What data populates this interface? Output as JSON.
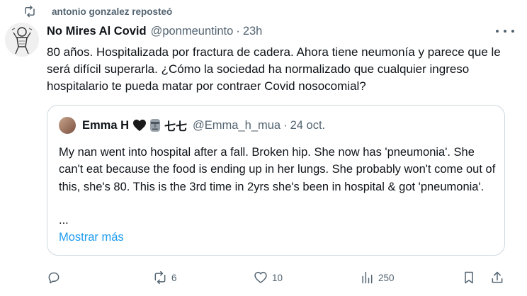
{
  "repost": {
    "icon": "repost-icon",
    "text": "antonio gonzalez reposteó"
  },
  "tweet": {
    "avatar": "avatar-illustration",
    "author_name": "No Mires Al Covid",
    "handle": "@ponmeuntinto",
    "separator": "·",
    "time": "23h",
    "more_icon": "more-icon",
    "text": "80 años. Hospitalizada por fractura de cadera. Ahora tiene neumonía y parece que le será difícil superarla. ¿Cómo la sociedad ha normalizado que cualquier ingreso hospitalario te pueda matar por contraer Covid nosocomial?"
  },
  "quote": {
    "author_name": "Emma H",
    "emoji_icons": [
      "black-heart-icon",
      "moai-icon"
    ],
    "name_suffix": "七七",
    "handle": "@Emma_h_mua",
    "separator": "·",
    "time": "24 oct.",
    "text": "My nan went into hospital after a fall. Broken hip. She now has 'pneumonia'. She can't eat because the food is ending up in her lungs. She probably won't come out of this, she's 80. This is the 3rd time in 2yrs she's been in hospital & got 'pneumonia'.",
    "ellipsis": "...",
    "show_more": "Mostrar más"
  },
  "actions": {
    "reply": {
      "icon": "reply-icon",
      "count": ""
    },
    "repost": {
      "icon": "repost-icon",
      "count": "6"
    },
    "like": {
      "icon": "heart-icon",
      "count": "10"
    },
    "views": {
      "icon": "views-icon",
      "count": "250"
    },
    "bookmark": {
      "icon": "bookmark-icon"
    },
    "share": {
      "icon": "share-icon"
    }
  },
  "colors": {
    "text": "#0f1419",
    "secondary": "#536471",
    "link": "#1d9bf0",
    "border": "#cfd9de"
  }
}
